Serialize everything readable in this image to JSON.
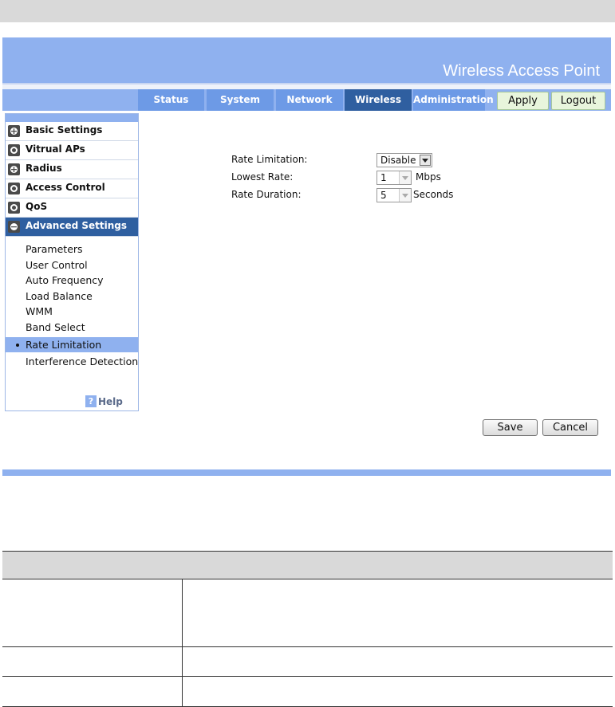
{
  "banner": {
    "title": "Wireless Access Point"
  },
  "tabs": [
    {
      "label": "Status"
    },
    {
      "label": "System"
    },
    {
      "label": "Network"
    },
    {
      "label": "Wireless"
    },
    {
      "label": "Administration"
    }
  ],
  "active_tab": "Wireless",
  "top_buttons": {
    "apply": "Apply",
    "logout": "Logout"
  },
  "sidebar": {
    "sections": [
      {
        "label": "Basic Settings",
        "icon": "plus-icon"
      },
      {
        "label": "Vitrual APs",
        "icon": "circle-icon"
      },
      {
        "label": "Radius",
        "icon": "plus-icon"
      },
      {
        "label": "Access Control",
        "icon": "circle-icon"
      },
      {
        "label": "QoS",
        "icon": "circle-icon"
      },
      {
        "label": "Advanced Settings",
        "icon": "minus-icon"
      }
    ],
    "subitems": [
      {
        "label": "Parameters"
      },
      {
        "label": "User Control"
      },
      {
        "label": "Auto Frequency"
      },
      {
        "label": "Load Balance"
      },
      {
        "label": "WMM"
      },
      {
        "label": "Band Select"
      },
      {
        "label": "Rate Limitation"
      },
      {
        "label": "Interference Detection"
      }
    ],
    "selected_subitem": "Rate Limitation",
    "help": {
      "icon_glyph": "?",
      "label": "Help"
    }
  },
  "form": {
    "rate_limitation": {
      "label": "Rate Limitation:",
      "value": "Disable"
    },
    "lowest_rate": {
      "label": "Lowest Rate:",
      "value": "1",
      "unit": "Mbps"
    },
    "rate_duration": {
      "label": "Rate Duration:",
      "value": "5",
      "unit": "Seconds"
    }
  },
  "actions": {
    "save": "Save",
    "cancel": "Cancel"
  },
  "colors": {
    "banner": "#8fb1ef",
    "tab": "#6d9ae6",
    "tab_active": "#2f5fa0",
    "selected_row": "#8fb1ef"
  }
}
